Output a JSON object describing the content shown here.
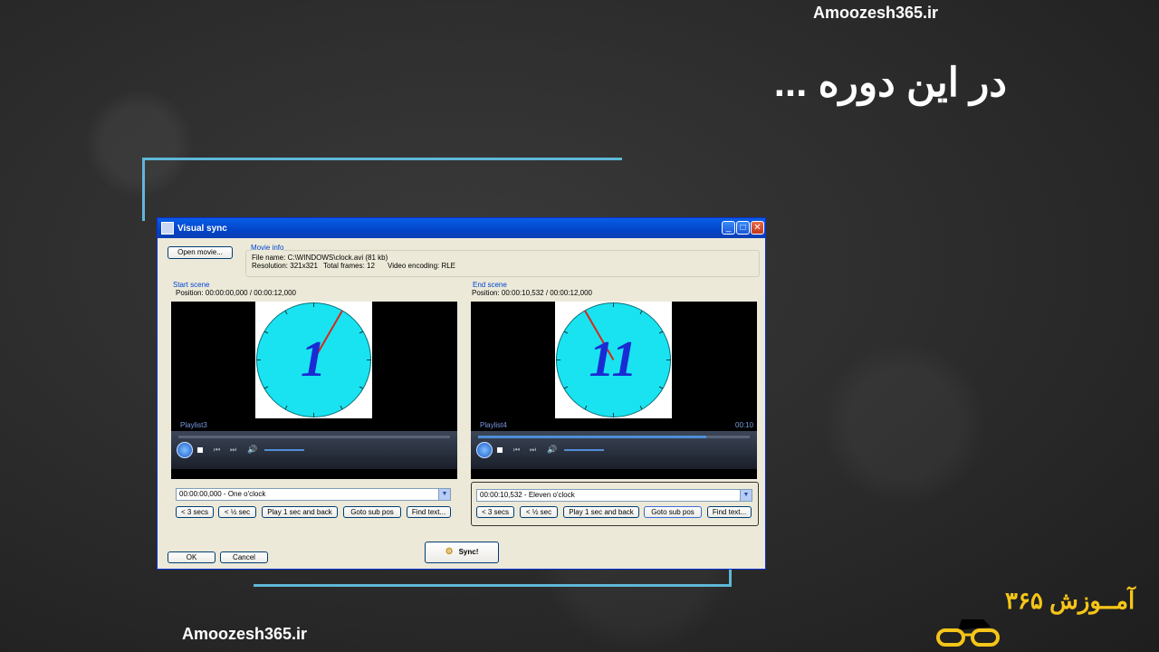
{
  "slide": {
    "site_top": "Amoozesh365.ir",
    "site_bottom": "Amoozesh365.ir",
    "headline": "در این دوره ...",
    "logo_text": "آمــوزش ۳۶۵"
  },
  "window": {
    "title": "Visual sync",
    "open_movie_label": "Open movie...",
    "movie_info_label": "Movie info",
    "file_name": "File name: C:\\WINDOWS\\clock.avi (81 kb)",
    "resolution": "Resolution: 321x321",
    "total_frames": "Total frames: 12",
    "video_encoding": "Video encoding: RLE",
    "ok_label": "OK",
    "cancel_label": "Cancel",
    "sync_label": "Sync!",
    "start": {
      "group_label": "Start scene",
      "position": "Position:  00:00:00,000 / 00:00:12,000",
      "playlist": "Playlist3",
      "clock_number": "1",
      "subtitle": "00:00:00,000 - One o'clock",
      "btn_back3": "< 3 secs",
      "btn_half": "< ½ sec",
      "btn_play": "Play 1 sec and back",
      "btn_goto": "Goto sub pos",
      "btn_find": "Find text..."
    },
    "end": {
      "group_label": "End scene",
      "position": "Position:  00:00:10,532 / 00:00:12,000",
      "playlist": "Playlist4",
      "time_badge": "00:10",
      "clock_number": "11",
      "subtitle": "00:00:10,532 - Eleven o'clock",
      "btn_back3": "< 3 secs",
      "btn_half": "< ½ sec",
      "btn_play": "Play 1 sec and back",
      "btn_goto": "Goto sub pos",
      "btn_find": "Find text..."
    }
  },
  "colors": {
    "frame_line": "#5fb7d8",
    "clock_face": "#19e3f0",
    "clock_number": "#1a2bd4",
    "hand": "#d9261c",
    "logo": "#f5c518"
  }
}
